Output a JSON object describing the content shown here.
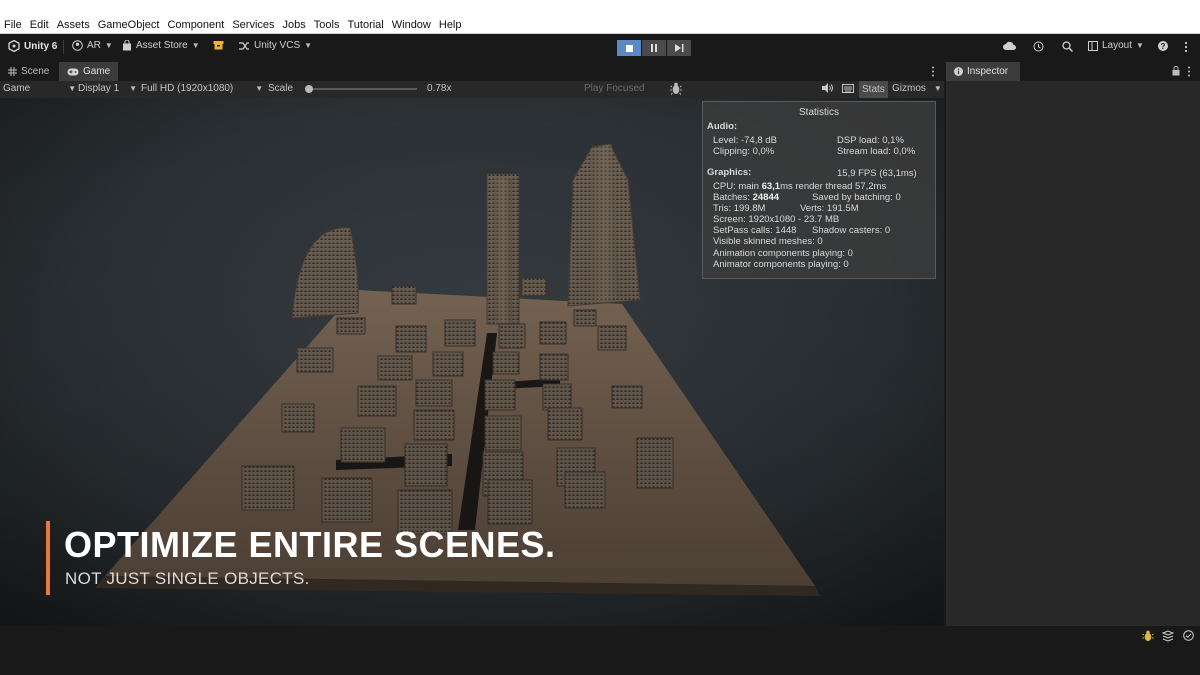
{
  "menu": [
    "File",
    "Edit",
    "Assets",
    "GameObject",
    "Component",
    "Services",
    "Jobs",
    "Tools",
    "Tutorial",
    "Window",
    "Help"
  ],
  "toolbar": {
    "unity_label": "Unity 6",
    "account_label": "AR",
    "asset_store_label": "Asset Store",
    "vcs_label": "Unity VCS",
    "layout_label": "Layout"
  },
  "tabs": {
    "scene": "Scene",
    "game": "Game",
    "inspector": "Inspector"
  },
  "gamebar": {
    "mode": "Game",
    "display": "Display 1",
    "resolution": "Full HD (1920x1080)",
    "scale_label": "Scale",
    "scale_value": "0.78x",
    "scale_level": 0.0,
    "play_focused": "Play Focused",
    "stats": "Stats",
    "gizmos": "Gizmos"
  },
  "stats": {
    "title": "Statistics",
    "audio_header": "Audio:",
    "level": "Level: -74,8 dB",
    "dsp": "DSP load: 0,1%",
    "clipping": "Clipping: 0,0%",
    "stream": "Stream load: 0,0%",
    "graphics_header": "Graphics:",
    "fps": "15,9 FPS (63,1ms)",
    "cpu_prefix": "CPU: main ",
    "cpu_main": "63,1",
    "cpu_suffix": "ms  render thread 57,2ms",
    "batches_prefix": "Batches: ",
    "batches": "24844",
    "saved_batching": "Saved by batching: 0",
    "tris": "Tris: 199.8M",
    "verts": "Verts: 191.5M",
    "screen": "Screen: 1920x1080 - 23.7 MB",
    "setpass": "SetPass calls: 1448",
    "shadow": "Shadow casters: 0",
    "skinned": "Visible skinned meshes: 0",
    "animation": "Animation components playing: 0",
    "animator": "Animator components playing: 0"
  },
  "caption": {
    "title": "OPTIMIZE ENTIRE SCENES.",
    "subtitle": "NOT JUST SINGLE OBJECTS."
  },
  "colors": {
    "accent": "#e8793a",
    "play_active": "#5a89c4",
    "ground": "#6e5c4b"
  }
}
